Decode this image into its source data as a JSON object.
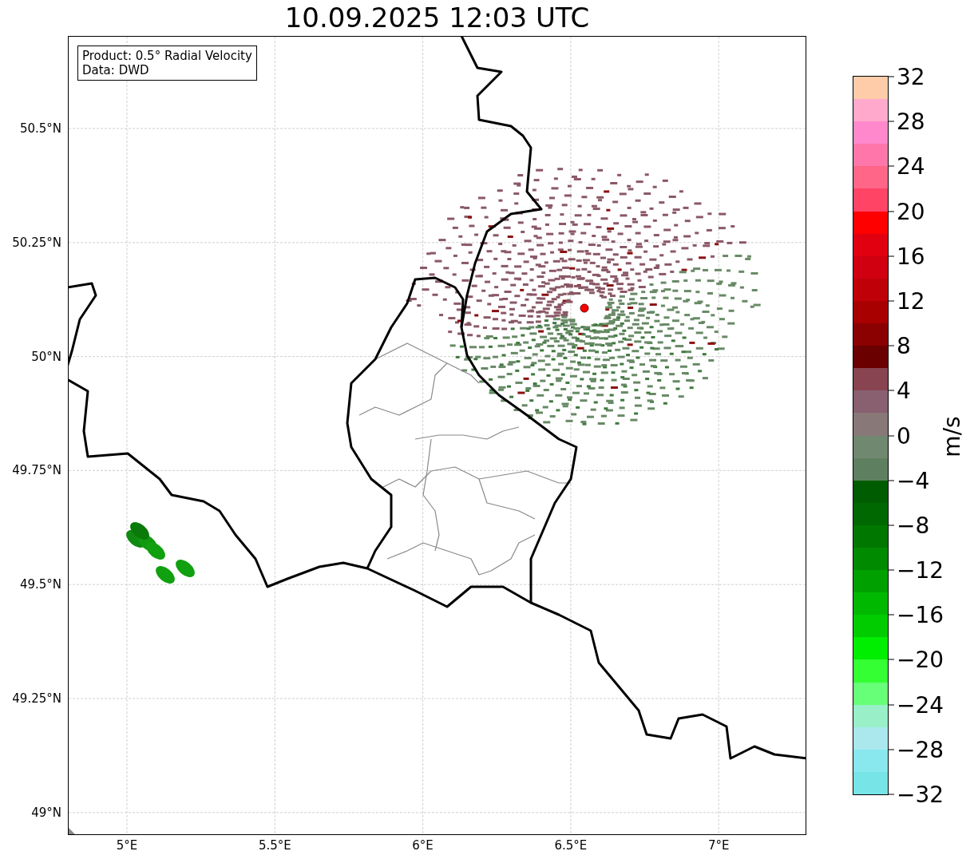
{
  "title": "10.09.2025 12:03 UTC",
  "info_box": {
    "lines": [
      "Product: 0.5° Radial Velocity",
      "Data: DWD"
    ]
  },
  "map": {
    "x_ticks": [
      "5°E",
      "5.5°E",
      "6°E",
      "6.5°E",
      "7°E"
    ],
    "y_ticks": [
      "50.5°N",
      "50.25°N",
      "50°N",
      "49.75°N",
      "49.5°N",
      "49.25°N",
      "49°N"
    ]
  },
  "colorbar": {
    "label": "m/s",
    "ticks": [
      "32",
      "28",
      "24",
      "20",
      "16",
      "12",
      "8",
      "4",
      "0",
      "−4",
      "−8",
      "−12",
      "−16",
      "−20",
      "−24",
      "−28",
      "−32"
    ],
    "segments": [
      {
        "color": "#ffccaa"
      },
      {
        "color": "#ffaacc"
      },
      {
        "color": "#ff88cc"
      },
      {
        "color": "#ff77aa"
      },
      {
        "color": "#ff6688"
      },
      {
        "color": "#ff4466"
      },
      {
        "color": "#ff0000"
      },
      {
        "color": "#e00010"
      },
      {
        "color": "#d00010"
      },
      {
        "color": "#c00008"
      },
      {
        "color": "#a80000"
      },
      {
        "color": "#8b0000"
      },
      {
        "color": "#6b0000"
      },
      {
        "color": "#884450"
      },
      {
        "color": "#886070"
      },
      {
        "color": "#887878"
      },
      {
        "color": "#708870"
      },
      {
        "color": "#5f8060"
      },
      {
        "color": "#005c00"
      },
      {
        "color": "#006800"
      },
      {
        "color": "#007800"
      },
      {
        "color": "#008a00"
      },
      {
        "color": "#00a000"
      },
      {
        "color": "#00b800"
      },
      {
        "color": "#00cc00"
      },
      {
        "color": "#00ee00"
      },
      {
        "color": "#33ff33"
      },
      {
        "color": "#66ff77"
      },
      {
        "color": "#99f0c8"
      },
      {
        "color": "#aae8ee"
      },
      {
        "color": "#88e8ee"
      },
      {
        "color": "#77e4e8"
      }
    ]
  }
}
